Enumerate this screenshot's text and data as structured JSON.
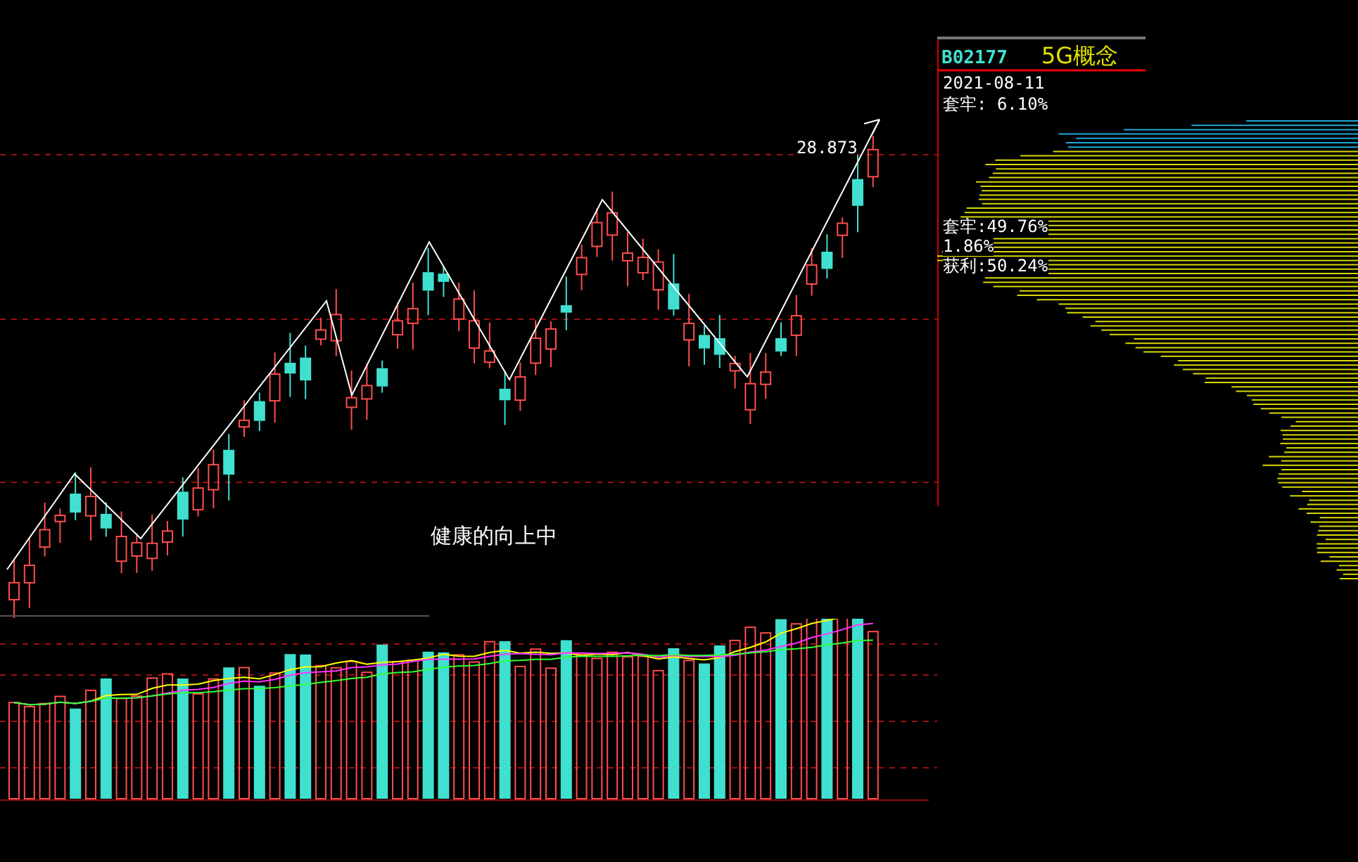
{
  "stock": {
    "code": "B02177",
    "sector": "5G概念"
  },
  "chip_panel": {
    "date": "2021-08-11",
    "trapped_top": "套牢: 6.10%",
    "trapped": "套牢:49.76%",
    "middle": "1.86%",
    "profit": "获利:50.24%"
  },
  "main_chart": {
    "high_label": "28.873",
    "trend_text": "健康的向上中"
  }
}
